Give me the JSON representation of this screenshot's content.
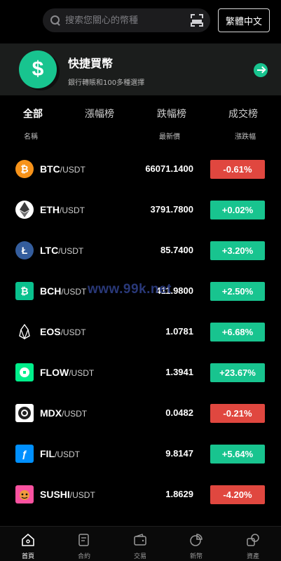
{
  "search": {
    "placeholder": "搜索您關心的幣種"
  },
  "lang_button": "繁體中文",
  "banner": {
    "title": "快捷買幣",
    "subtitle": "銀行轉賬和100多種選擇"
  },
  "tabs": [
    {
      "label": "全部",
      "active": true
    },
    {
      "label": "漲幅榜",
      "active": false
    },
    {
      "label": "跌幅榜",
      "active": false
    },
    {
      "label": "成交榜",
      "active": false
    }
  ],
  "columns": {
    "name": "名稱",
    "price": "最新價",
    "change": "漲跌幅"
  },
  "rows": [
    {
      "symbol": "BTC",
      "quote": "/USDT",
      "price": "66071.1400",
      "change": "-0.61%",
      "direction": "down",
      "icon": "bitcoin-icon",
      "icon_color": "#f7931a"
    },
    {
      "symbol": "ETH",
      "quote": "/USDT",
      "price": "3791.7800",
      "change": "+0.02%",
      "direction": "up",
      "icon": "ethereum-icon",
      "icon_color": "#ffffff"
    },
    {
      "symbol": "LTC",
      "quote": "/USDT",
      "price": "85.7400",
      "change": "+3.20%",
      "direction": "up",
      "icon": "litecoin-icon",
      "icon_color": "#345d9d"
    },
    {
      "symbol": "BCH",
      "quote": "/USDT",
      "price": "411.9800",
      "change": "+2.50%",
      "direction": "up",
      "icon": "bitcoin-cash-icon",
      "icon_color": "#0ac18e"
    },
    {
      "symbol": "EOS",
      "quote": "/USDT",
      "price": "1.0781",
      "change": "+6.68%",
      "direction": "up",
      "icon": "eos-icon",
      "icon_color": "#000000"
    },
    {
      "symbol": "FLOW",
      "quote": "/USDT",
      "price": "1.3941",
      "change": "+23.67%",
      "direction": "up",
      "icon": "flow-icon",
      "icon_color": "#00ef8b"
    },
    {
      "symbol": "MDX",
      "quote": "/USDT",
      "price": "0.0482",
      "change": "-0.21%",
      "direction": "down",
      "icon": "mdex-icon",
      "icon_color": "#ffffff"
    },
    {
      "symbol": "FIL",
      "quote": "/USDT",
      "price": "9.8147",
      "change": "+5.64%",
      "direction": "up",
      "icon": "filecoin-icon",
      "icon_color": "#0090ff"
    },
    {
      "symbol": "SUSHI",
      "quote": "/USDT",
      "price": "1.8629",
      "change": "-4.20%",
      "direction": "down",
      "icon": "sushi-icon",
      "icon_color": "#fa52a0"
    }
  ],
  "watermark": "www.99k.net",
  "nav": [
    {
      "label": "首頁",
      "icon": "home-icon",
      "active": true
    },
    {
      "label": "合約",
      "icon": "contract-icon",
      "active": false
    },
    {
      "label": "交易",
      "icon": "wallet-icon",
      "active": false
    },
    {
      "label": "新幣",
      "icon": "pie-chart-icon",
      "active": false
    },
    {
      "label": "資產",
      "icon": "assets-icon",
      "active": false
    }
  ],
  "colors": {
    "up": "#18c48f",
    "down": "#e0473f",
    "accent": "#18c48f"
  }
}
